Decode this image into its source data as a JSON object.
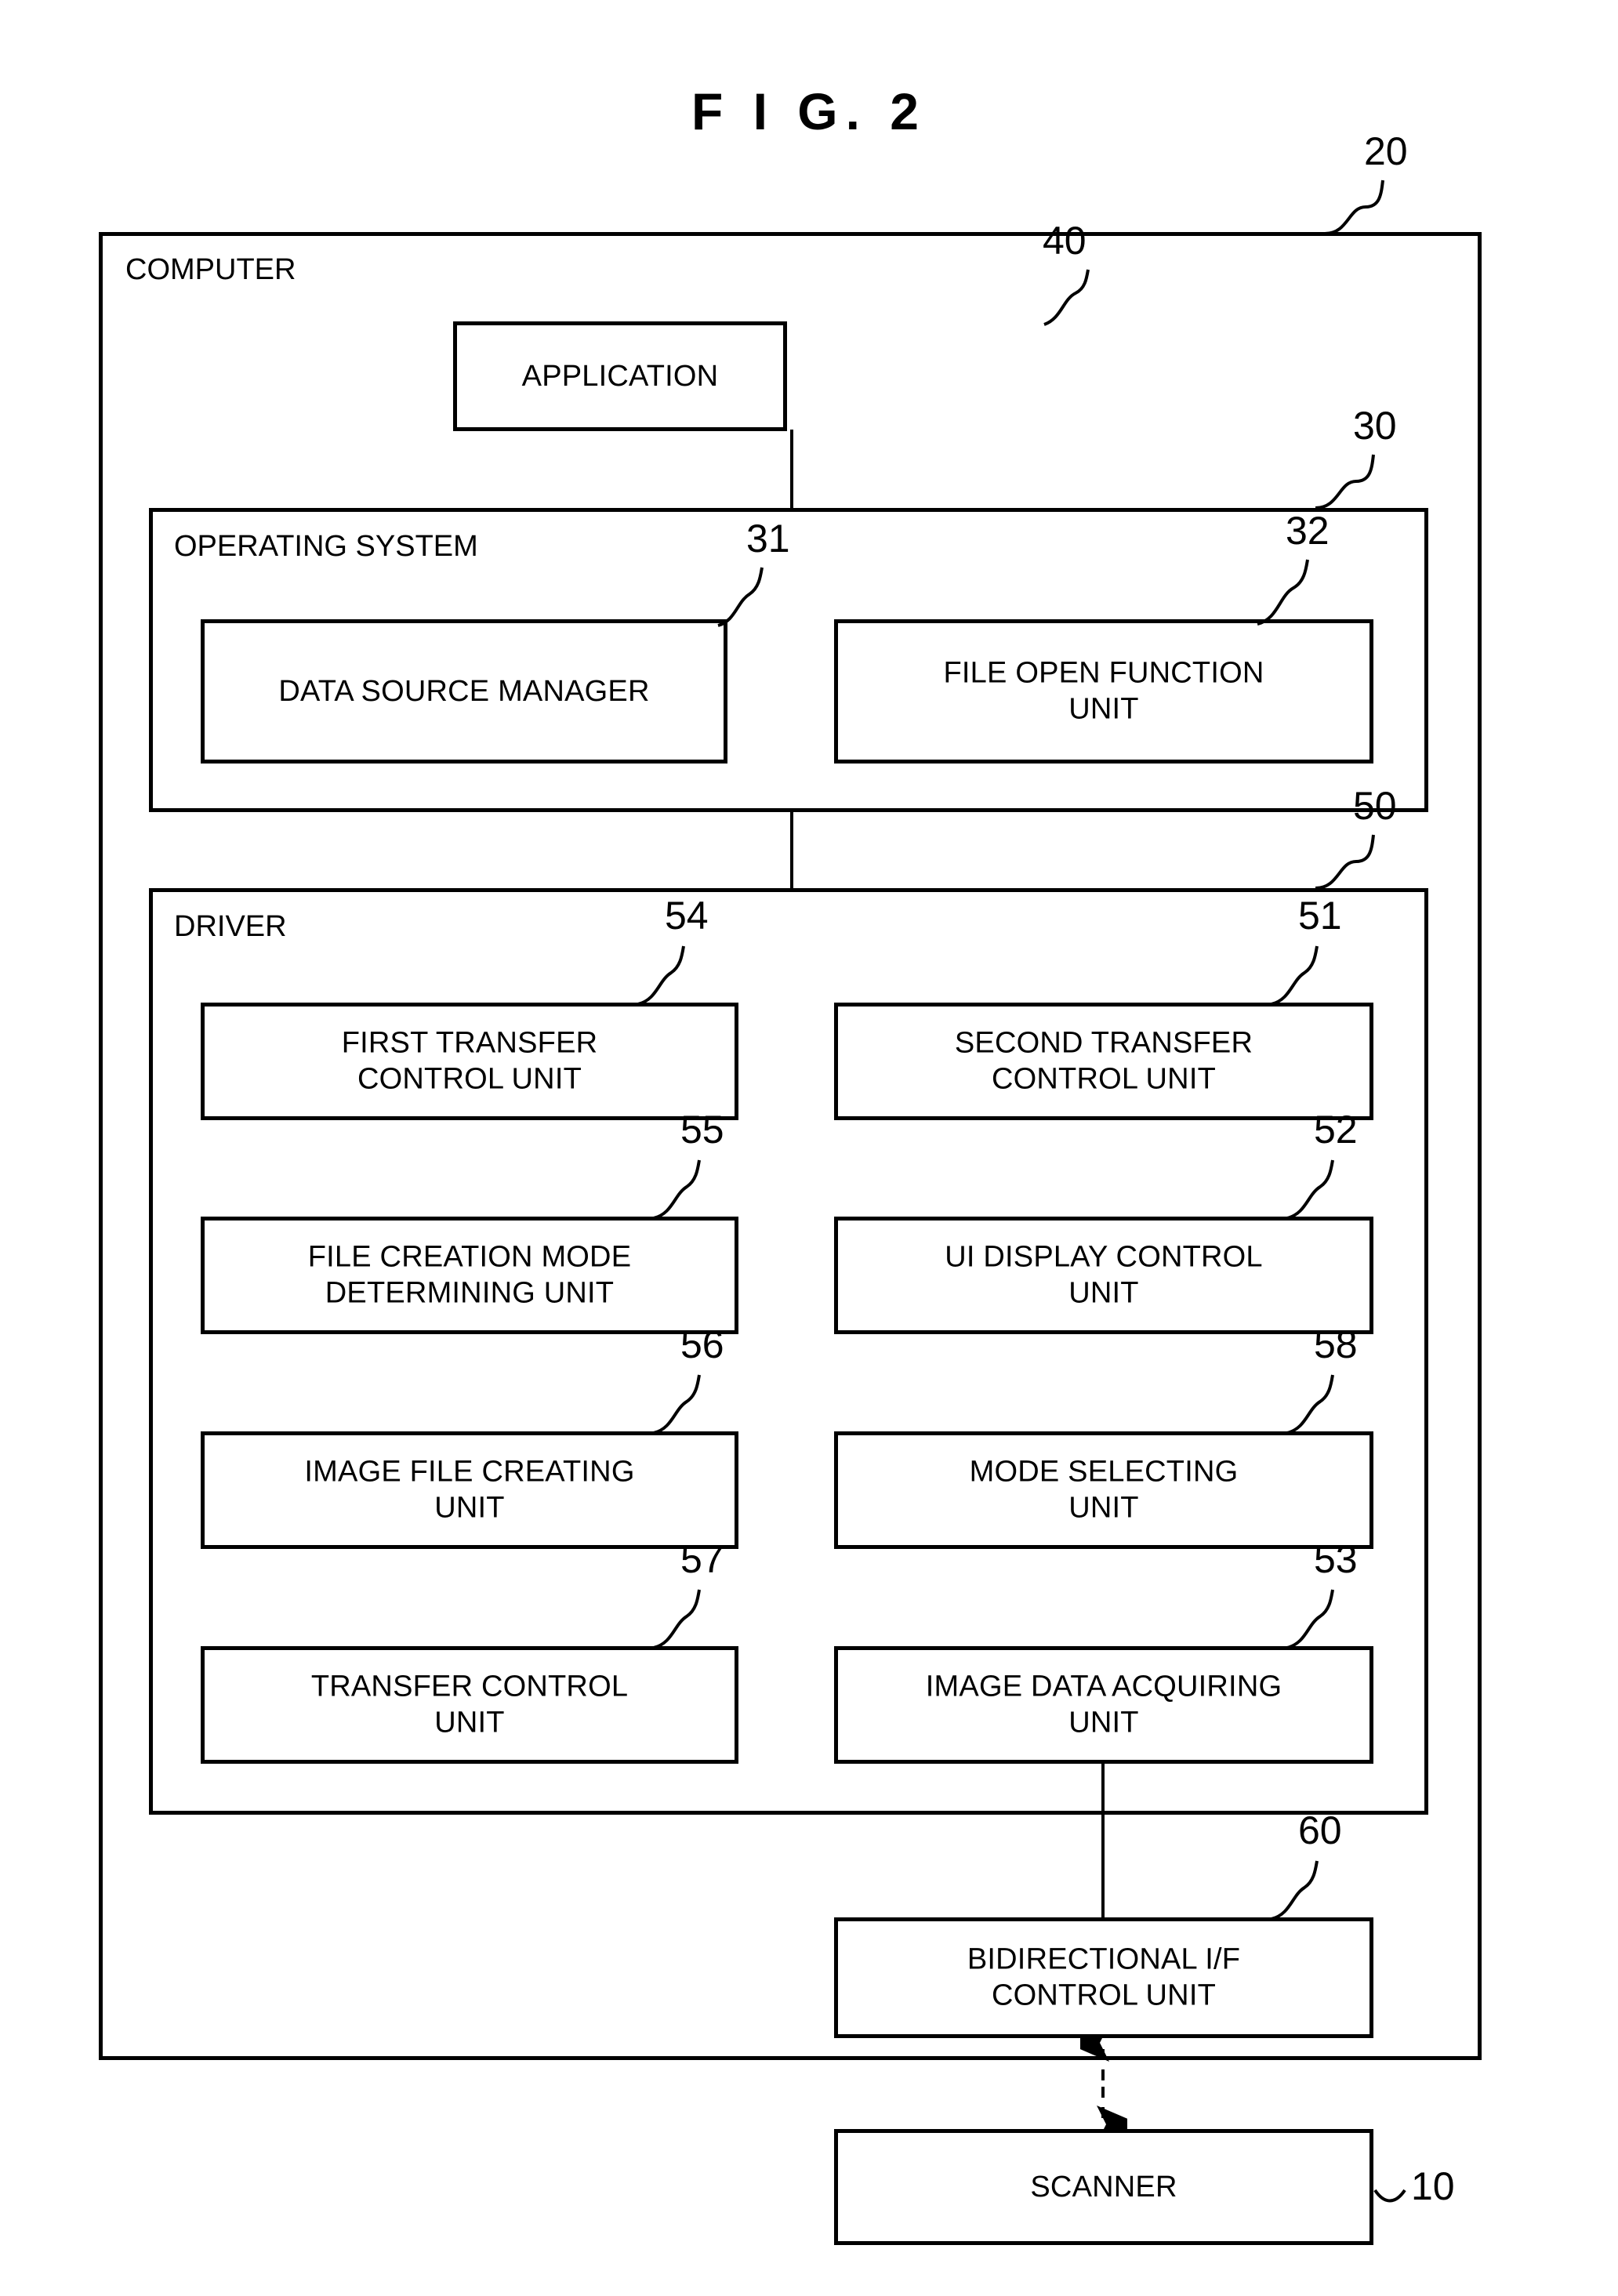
{
  "figure": {
    "title": "F I G.  2"
  },
  "computer": {
    "label": "COMPUTER",
    "ref": "20"
  },
  "application": {
    "label": "APPLICATION",
    "ref": "40"
  },
  "operating_system": {
    "label": "OPERATING SYSTEM",
    "ref": "30",
    "units": [
      {
        "label": "DATA SOURCE MANAGER",
        "ref": "31"
      },
      {
        "label": "FILE OPEN FUNCTION\nUNIT",
        "ref": "32"
      }
    ]
  },
  "driver": {
    "label": "DRIVER",
    "ref": "50",
    "left_column": [
      {
        "label": "FIRST TRANSFER\nCONTROL UNIT",
        "ref": "54"
      },
      {
        "label": "FILE CREATION MODE\nDETERMINING UNIT",
        "ref": "55"
      },
      {
        "label": "IMAGE FILE CREATING\nUNIT",
        "ref": "56"
      },
      {
        "label": "TRANSFER CONTROL\nUNIT",
        "ref": "57"
      }
    ],
    "right_column": [
      {
        "label": "SECOND TRANSFER\nCONTROL UNIT",
        "ref": "51"
      },
      {
        "label": "UI DISPLAY CONTROL\nUNIT",
        "ref": "52"
      },
      {
        "label": "MODE SELECTING\nUNIT",
        "ref": "58"
      },
      {
        "label": "IMAGE DATA ACQUIRING\nUNIT",
        "ref": "53"
      }
    ]
  },
  "bidirectional_if": {
    "label": "BIDIRECTIONAL I/F\nCONTROL UNIT",
    "ref": "60"
  },
  "scanner": {
    "label": "SCANNER",
    "ref": "10"
  },
  "colors": {
    "ink": "#000000",
    "paper": "#ffffff"
  }
}
